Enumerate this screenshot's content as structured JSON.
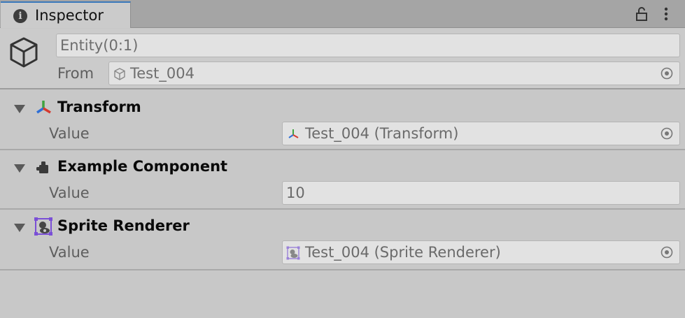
{
  "tab": {
    "title": "Inspector",
    "info_icon": "info-icon",
    "lock_icon": "lock-icon",
    "more_icon": "more-vertical-icon"
  },
  "header": {
    "object_icon": "gameobject-cube-icon",
    "entity_name": "Entity(0:1)",
    "from_label": "From",
    "from_value": "Test_004"
  },
  "components": [
    {
      "title": "Transform",
      "icon": "transform-axes-icon",
      "property_label": "Value",
      "property_value": "Test_004 (Transform)"
    },
    {
      "title": "Example Component",
      "icon": "script-component-icon",
      "property_label": "Value",
      "property_value": "10"
    },
    {
      "title": "Sprite Renderer",
      "icon": "sprite-renderer-icon",
      "property_label": "Value",
      "property_value": "Test_004 (Sprite Renderer)"
    }
  ],
  "colors": {
    "tab_accent": "#3a79bb",
    "panel_bg": "#c8c8c8",
    "field_bg": "#e2e2e2",
    "sprite_icon_purple": "#7a4fd6"
  }
}
